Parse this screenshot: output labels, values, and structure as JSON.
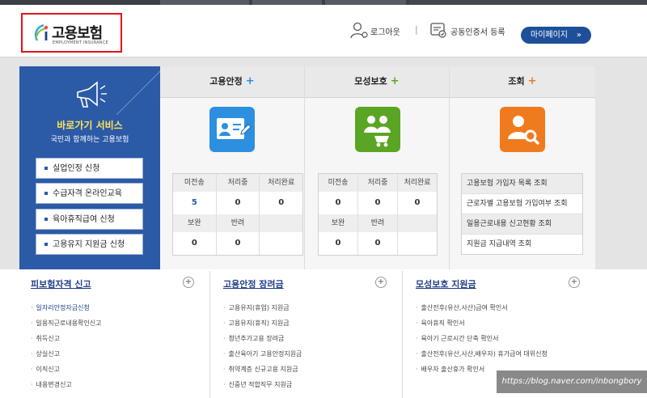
{
  "header": {
    "logo_title": "고용보험",
    "logo_subtitle": "EMPLOYMENT INSURANCE",
    "logout_label": "로그아웃",
    "separator": "|",
    "cert_label": "공동인증서 등록",
    "mypage_label": "마이페이지",
    "mypage_arrow": "»"
  },
  "quick": {
    "title": "바로가기 서비스",
    "subtitle": "국민과 함께하는 고용보험",
    "buttons": [
      {
        "label": "실업인정 신청"
      },
      {
        "label": "수급자격 온라인교육"
      },
      {
        "label": "육아휴직급여 신청"
      },
      {
        "label": "고용유지 지원금 신청"
      }
    ]
  },
  "panels": {
    "employment": {
      "title": "고용안정",
      "plus": "+",
      "plus_color": "#2c8fe0",
      "headers1": [
        "미전송",
        "처리중",
        "처리완료"
      ],
      "values1": [
        "5",
        "0",
        "0"
      ],
      "headers2": [
        "보완",
        "반려",
        ""
      ],
      "values2": [
        "0",
        "0",
        ""
      ]
    },
    "maternity": {
      "title": "모성보호",
      "plus": "+",
      "plus_color": "#5aa524",
      "headers1": [
        "미전송",
        "처리중",
        "처리완료"
      ],
      "values1": [
        "0",
        "0",
        "0"
      ],
      "headers2": [
        "보완",
        "반려",
        ""
      ],
      "values2": [
        "0",
        "0",
        ""
      ]
    },
    "lookup": {
      "title": "조회",
      "plus": "+",
      "plus_color": "#f07b1e",
      "items": [
        "고용보험 가입자 목록 조회",
        "근로자별 고용보험 가입여부 조회",
        "일용근로내용 신고현황 조회",
        "지원금 지급내역 조회"
      ]
    }
  },
  "lower": {
    "col1": {
      "title": "피보험자격 신고",
      "plus": "+",
      "items": [
        "일자리안정자금신청",
        "일용직근로내용확인신고",
        "취득신고",
        "상실신고",
        "이직신고",
        "내용변경신고"
      ]
    },
    "col2": {
      "title": "고용안정 장려금",
      "plus": "+",
      "items": [
        "고용유지(휴업) 지원금",
        "고용유지(휴직) 지원금",
        "청년추가고용 장려금",
        "출산육아기 고용안정지원금",
        "취약계층 신규고용 지원금",
        "신중년 적합직무 지원금"
      ]
    },
    "col3": {
      "title": "모성보호 지원금",
      "plus": "+",
      "items": [
        "출산전후(유산,사산)급여 확인서",
        "육아휴직 확인서",
        "육아기 근로시간 단축 확인서",
        "출산전후(유산,사산,배우자) 휴가급여 대위신청",
        "배우자 출산휴가 확인서"
      ]
    }
  },
  "watermark": "https://blog.naver.com/inbongbory",
  "colors": {
    "brand_blue": "#2b5aa6",
    "mypage_blue": "#1d4f9a",
    "logo_border": "#e0141b",
    "icon_blue": "#2c8fe0",
    "icon_green": "#5aa524",
    "icon_orange": "#f07b1e"
  },
  "icons": [
    "user-logout-icon",
    "certificate-icon",
    "megaphone-icon",
    "id-card-icon",
    "family-icon",
    "search-user-icon"
  ]
}
